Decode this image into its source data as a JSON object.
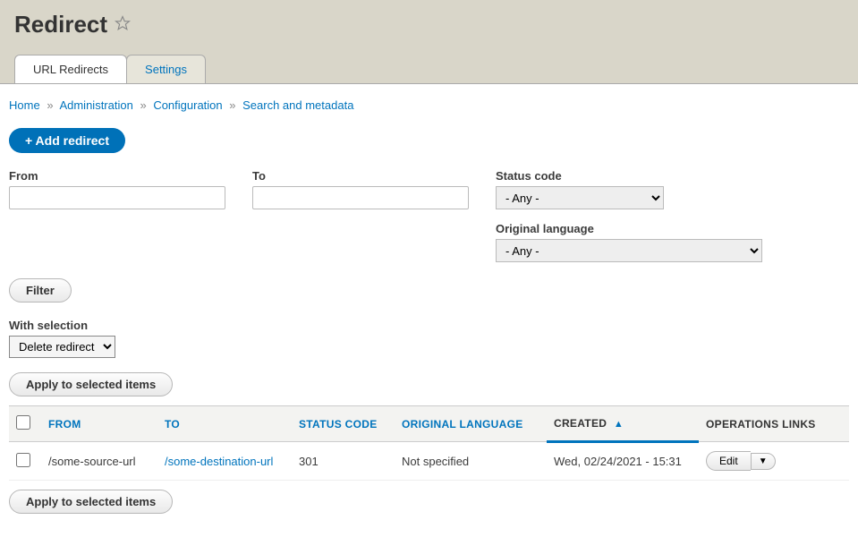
{
  "header": {
    "title": "Redirect"
  },
  "tabs": [
    {
      "label": "URL Redirects"
    },
    {
      "label": "Settings"
    }
  ],
  "breadcrumb": [
    {
      "label": "Home"
    },
    {
      "label": "Administration"
    },
    {
      "label": "Configuration"
    },
    {
      "label": "Search and metadata"
    }
  ],
  "actions": {
    "add": "+ Add redirect",
    "filter": "Filter",
    "apply": "Apply to selected items"
  },
  "filters": {
    "from_label": "From",
    "from_value": "",
    "to_label": "To",
    "to_value": "",
    "status_label": "Status code",
    "status_selected": "- Any -",
    "lang_label": "Original language",
    "lang_selected": "- Any -"
  },
  "bulk": {
    "label": "With selection",
    "selected": "Delete redirect"
  },
  "table": {
    "headers": {
      "from": "FROM",
      "to": "TO",
      "status": "STATUS CODE",
      "lang": "ORIGINAL LANGUAGE",
      "created": "CREATED",
      "ops": "OPERATIONS LINKS"
    },
    "rows": [
      {
        "from": "/some-source-url",
        "to": "/some-destination-url",
        "status": "301",
        "lang": "Not specified",
        "created": "Wed, 02/24/2021 - 15:31",
        "edit": "Edit"
      }
    ]
  }
}
